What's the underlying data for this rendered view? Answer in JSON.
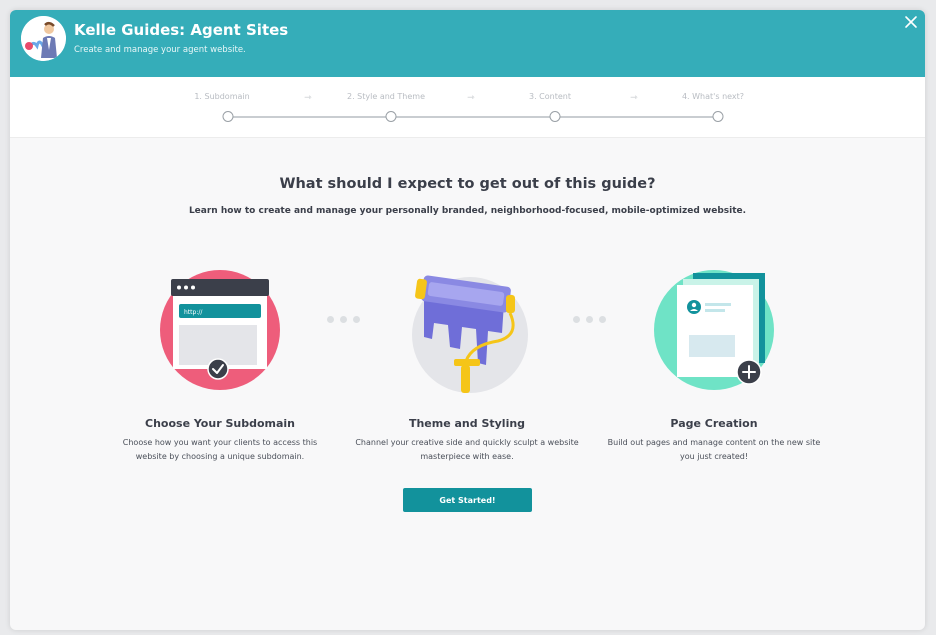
{
  "header": {
    "title": "Kelle Guides: Agent Sites",
    "subtitle": "Create and manage your agent website."
  },
  "stepper": {
    "steps": [
      "1. Subdomain",
      "2. Style and Theme",
      "3. Content",
      "4. What's next?"
    ],
    "arrow": "⇾"
  },
  "main": {
    "title": "What should I expect to get out of this guide?",
    "subtitle": "Learn how to create and manage your personally branded, neighborhood-focused, mobile-optimized website."
  },
  "features": [
    {
      "title": "Choose Your Subdomain",
      "description": "Choose how you want your clients to access this website by choosing a unique subdomain.",
      "illustration_url_text": "http://"
    },
    {
      "title": "Theme and Styling",
      "description": "Channel your creative side and quickly sculpt a website masterpiece with ease."
    },
    {
      "title": "Page Creation",
      "description": "Build out pages and manage content on the new site you just created!"
    }
  ],
  "cta": {
    "label": "Get Started!"
  },
  "colors": {
    "header": "#35adb9",
    "accent": "#12929c",
    "pink": "#ee5d7b",
    "teal_light": "#6fe3c6",
    "purple": "#6f6ed8",
    "yellow": "#f5c518",
    "dark": "#3b3f4a"
  },
  "icons": [
    "close-icon",
    "agent-avatar",
    "browser-window-illustration",
    "paint-roller-illustration",
    "page-document-illustration",
    "check-icon",
    "plus-icon",
    "step-arrow-icon"
  ]
}
